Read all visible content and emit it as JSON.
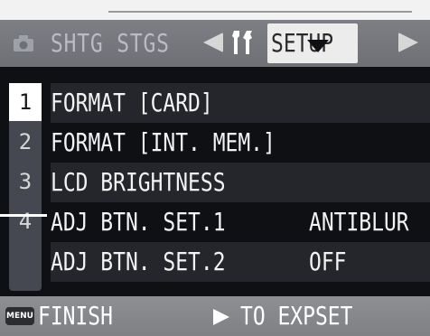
{
  "tabs": {
    "prev_icon": "camera-icon",
    "shtg_label": "SHTG STGS",
    "setup_label": "SETUP",
    "tools_icon": "wrench-screwdriver-icon"
  },
  "rail": {
    "numbers": [
      "1",
      "2",
      "3",
      "4"
    ]
  },
  "menu": {
    "items": [
      {
        "label": "FORMAT  [CARD]",
        "value": ""
      },
      {
        "label": "FORMAT  [INT. MEM.]",
        "value": ""
      },
      {
        "label": "LCD BRIGHTNESS",
        "value": ""
      },
      {
        "label": "ADJ BTN. SET.1",
        "value": "ANTIBLUR"
      },
      {
        "label": "ADJ BTN. SET.2",
        "value": "OFF"
      }
    ]
  },
  "bottom": {
    "menu_icon_text": "MENU",
    "finish_label": "FINISH",
    "to_expset_label": "TO EXPSET"
  },
  "colors": {
    "background": "#0f1014",
    "tab_bar": "#6e7076",
    "selected_tab": "#ececec",
    "row_alt": "#24262c",
    "bottom_bar": "#7e8084"
  }
}
